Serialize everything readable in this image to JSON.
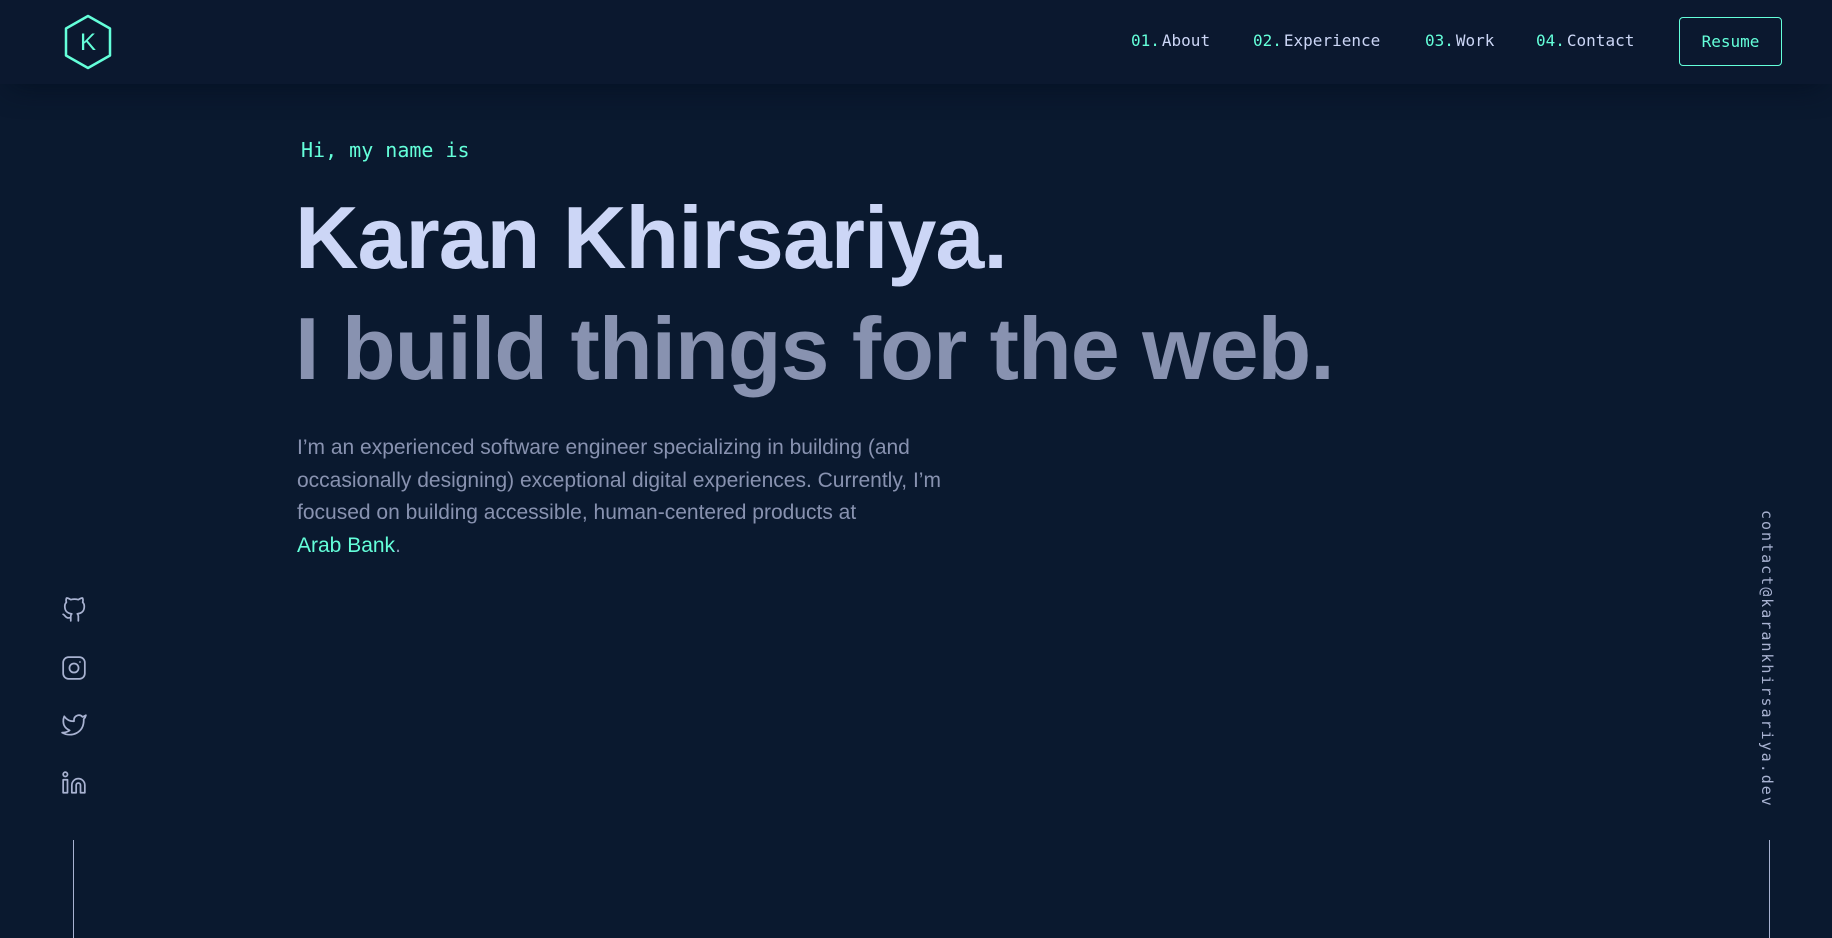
{
  "colors": {
    "background": "#0a192f",
    "accent": "#64ffda",
    "heading": "#ccd6f6",
    "muted": "#8892b0",
    "light": "#a8b2d1"
  },
  "header": {
    "logo_letter": "K",
    "logo_icon": "hexagon-logo-icon",
    "nav": [
      {
        "num": "01.",
        "label": "About"
      },
      {
        "num": "02.",
        "label": "Experience"
      },
      {
        "num": "03.",
        "label": "Work"
      },
      {
        "num": "04.",
        "label": "Contact"
      }
    ],
    "resume_label": "Resume"
  },
  "hero": {
    "greeting": "Hi, my name is",
    "name": "Karan Khirsariya.",
    "tagline": "I build things for the web.",
    "intro_text": "I’m an experienced software engineer specializing in building (and occasionally designing) exceptional digital experiences. Currently, I’m focused on building accessible, human-centered products at",
    "intro_link": "Arab Bank",
    "intro_end": "."
  },
  "social": [
    {
      "icon": "github-icon"
    },
    {
      "icon": "instagram-icon"
    },
    {
      "icon": "twitter-icon"
    },
    {
      "icon": "linkedin-icon"
    }
  ],
  "email": "contact@karankhirsariya.dev"
}
